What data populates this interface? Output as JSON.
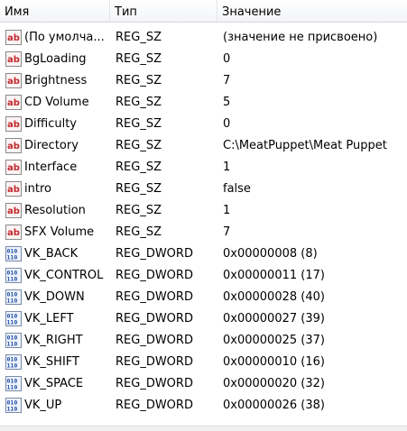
{
  "columns": {
    "name": "Имя",
    "type": "Тип",
    "value": "Значение"
  },
  "rows": [
    {
      "icon": "string-value-icon",
      "name": "(По умолча...",
      "type": "REG_SZ",
      "value": "(значение не присвоено)"
    },
    {
      "icon": "string-value-icon",
      "name": "BgLoading",
      "type": "REG_SZ",
      "value": "0"
    },
    {
      "icon": "string-value-icon",
      "name": "Brightness",
      "type": "REG_SZ",
      "value": "7"
    },
    {
      "icon": "string-value-icon",
      "name": "CD Volume",
      "type": "REG_SZ",
      "value": "5"
    },
    {
      "icon": "string-value-icon",
      "name": "Difficulty",
      "type": "REG_SZ",
      "value": "0"
    },
    {
      "icon": "string-value-icon",
      "name": "Directory",
      "type": "REG_SZ",
      "value": "C:\\MeatPuppet\\Meat Puppet"
    },
    {
      "icon": "string-value-icon",
      "name": "Interface",
      "type": "REG_SZ",
      "value": "1"
    },
    {
      "icon": "string-value-icon",
      "name": "intro",
      "type": "REG_SZ",
      "value": "false"
    },
    {
      "icon": "string-value-icon",
      "name": "Resolution",
      "type": "REG_SZ",
      "value": "1"
    },
    {
      "icon": "string-value-icon",
      "name": "SFX Volume",
      "type": "REG_SZ",
      "value": "7"
    },
    {
      "icon": "dword-value-icon",
      "name": "VK_BACK",
      "type": "REG_DWORD",
      "value": "0x00000008 (8)"
    },
    {
      "icon": "dword-value-icon",
      "name": "VK_CONTROL",
      "type": "REG_DWORD",
      "value": "0x00000011 (17)"
    },
    {
      "icon": "dword-value-icon",
      "name": "VK_DOWN",
      "type": "REG_DWORD",
      "value": "0x00000028 (40)"
    },
    {
      "icon": "dword-value-icon",
      "name": "VK_LEFT",
      "type": "REG_DWORD",
      "value": "0x00000027 (39)"
    },
    {
      "icon": "dword-value-icon",
      "name": "VK_RIGHT",
      "type": "REG_DWORD",
      "value": "0x00000025 (37)"
    },
    {
      "icon": "dword-value-icon",
      "name": "VK_SHIFT",
      "type": "REG_DWORD",
      "value": "0x00000010 (16)"
    },
    {
      "icon": "dword-value-icon",
      "name": "VK_SPACE",
      "type": "REG_DWORD",
      "value": "0x00000020 (32)"
    },
    {
      "icon": "dword-value-icon",
      "name": "VK_UP",
      "type": "REG_DWORD",
      "value": "0x00000026 (38)"
    }
  ]
}
